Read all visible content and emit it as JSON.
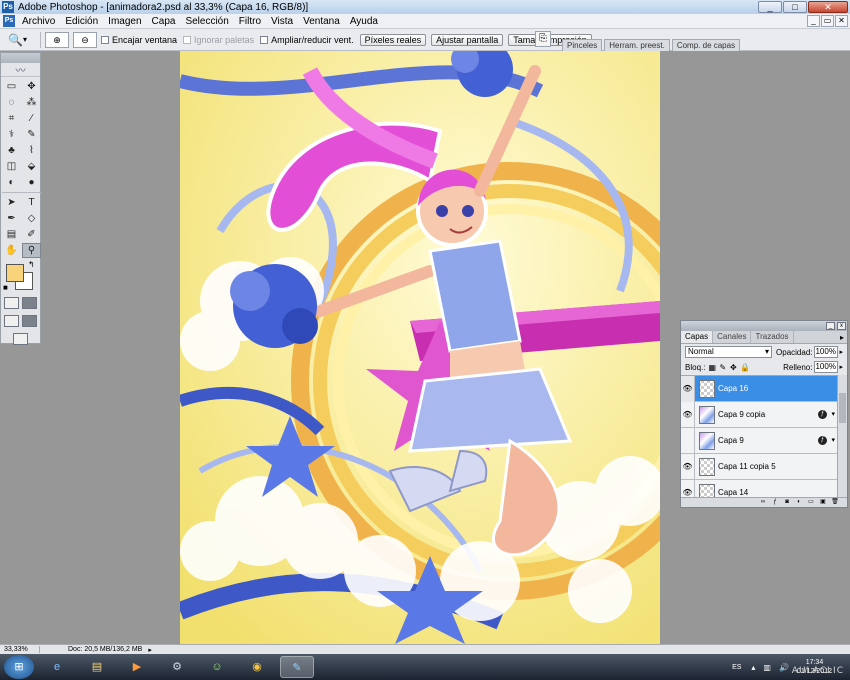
{
  "window": {
    "title": "Adobe Photoshop - [animadora2.psd al 33,3% (Capa 16, RGB/8)]",
    "controls": [
      "_",
      "□",
      "✕"
    ],
    "doc_controls": [
      "_",
      "▭",
      "✕"
    ]
  },
  "menu": [
    "Archivo",
    "Edición",
    "Imagen",
    "Capa",
    "Selección",
    "Filtro",
    "Vista",
    "Ventana",
    "Ayuda"
  ],
  "options": {
    "checks": [
      {
        "label": "Encajar ventana",
        "disabled": false
      },
      {
        "label": "Ignorar paletas",
        "disabled": true
      },
      {
        "label": "Ampliar/reducir vent.",
        "disabled": false
      }
    ],
    "buttons": [
      "Píxeles reales",
      "Ajustar pantalla",
      "Tamaño impresión"
    ],
    "palette_tabs": [
      "Pinceles",
      "Herram. preest.",
      "Comp. de capas"
    ]
  },
  "toolbox": {
    "tools": [
      "▭",
      "✥",
      "◌",
      "⁂",
      "⌗",
      "∕",
      "⚕",
      "✎",
      "♣",
      "⌇",
      "◫",
      "⬙",
      "◐",
      "●",
      "➤",
      "T",
      "✒",
      "◇",
      "▤",
      "✐",
      "✋",
      "⚲"
    ],
    "fg_color": "#f8d37c",
    "bg_color": "#ffffff"
  },
  "layers_panel": {
    "tabs": [
      "Capas",
      "Canales",
      "Trazados"
    ],
    "blend_mode": "Normal",
    "opacity_label": "Opacidad:",
    "opacity": "100%",
    "lock_label": "Bloq.:",
    "fill_label": "Relleno:",
    "fill": "100%",
    "layers": [
      {
        "name": "Capa 16",
        "selected": true,
        "visible": true,
        "fx": false,
        "art": false
      },
      {
        "name": "Capa 9 copia",
        "selected": false,
        "visible": true,
        "fx": true,
        "art": true
      },
      {
        "name": "Capa 9",
        "selected": false,
        "visible": false,
        "fx": true,
        "art": true
      },
      {
        "name": "Capa 11 copia 5",
        "selected": false,
        "visible": true,
        "fx": false,
        "art": false
      },
      {
        "name": "Capa 14",
        "selected": false,
        "visible": true,
        "fx": false,
        "art": false
      }
    ]
  },
  "status": {
    "zoom": "33,33%",
    "doc": "Doc: 20,5 MB/136,2 MB"
  },
  "taskbar": {
    "lang": "ES",
    "time": "17:34",
    "date": "01/12/2012"
  },
  "watermark": "AULACLIC"
}
